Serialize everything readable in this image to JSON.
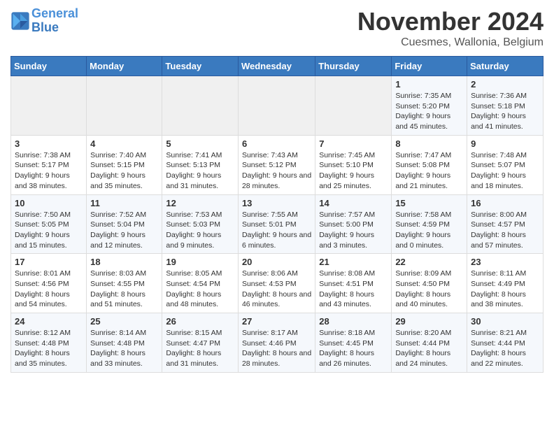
{
  "header": {
    "logo_line1": "General",
    "logo_line2": "Blue",
    "month": "November 2024",
    "location": "Cuesmes, Wallonia, Belgium"
  },
  "weekdays": [
    "Sunday",
    "Monday",
    "Tuesday",
    "Wednesday",
    "Thursday",
    "Friday",
    "Saturday"
  ],
  "weeks": [
    [
      {
        "day": "",
        "info": ""
      },
      {
        "day": "",
        "info": ""
      },
      {
        "day": "",
        "info": ""
      },
      {
        "day": "",
        "info": ""
      },
      {
        "day": "",
        "info": ""
      },
      {
        "day": "1",
        "info": "Sunrise: 7:35 AM\nSunset: 5:20 PM\nDaylight: 9 hours and 45 minutes."
      },
      {
        "day": "2",
        "info": "Sunrise: 7:36 AM\nSunset: 5:18 PM\nDaylight: 9 hours and 41 minutes."
      }
    ],
    [
      {
        "day": "3",
        "info": "Sunrise: 7:38 AM\nSunset: 5:17 PM\nDaylight: 9 hours and 38 minutes."
      },
      {
        "day": "4",
        "info": "Sunrise: 7:40 AM\nSunset: 5:15 PM\nDaylight: 9 hours and 35 minutes."
      },
      {
        "day": "5",
        "info": "Sunrise: 7:41 AM\nSunset: 5:13 PM\nDaylight: 9 hours and 31 minutes."
      },
      {
        "day": "6",
        "info": "Sunrise: 7:43 AM\nSunset: 5:12 PM\nDaylight: 9 hours and 28 minutes."
      },
      {
        "day": "7",
        "info": "Sunrise: 7:45 AM\nSunset: 5:10 PM\nDaylight: 9 hours and 25 minutes."
      },
      {
        "day": "8",
        "info": "Sunrise: 7:47 AM\nSunset: 5:08 PM\nDaylight: 9 hours and 21 minutes."
      },
      {
        "day": "9",
        "info": "Sunrise: 7:48 AM\nSunset: 5:07 PM\nDaylight: 9 hours and 18 minutes."
      }
    ],
    [
      {
        "day": "10",
        "info": "Sunrise: 7:50 AM\nSunset: 5:05 PM\nDaylight: 9 hours and 15 minutes."
      },
      {
        "day": "11",
        "info": "Sunrise: 7:52 AM\nSunset: 5:04 PM\nDaylight: 9 hours and 12 minutes."
      },
      {
        "day": "12",
        "info": "Sunrise: 7:53 AM\nSunset: 5:03 PM\nDaylight: 9 hours and 9 minutes."
      },
      {
        "day": "13",
        "info": "Sunrise: 7:55 AM\nSunset: 5:01 PM\nDaylight: 9 hours and 6 minutes."
      },
      {
        "day": "14",
        "info": "Sunrise: 7:57 AM\nSunset: 5:00 PM\nDaylight: 9 hours and 3 minutes."
      },
      {
        "day": "15",
        "info": "Sunrise: 7:58 AM\nSunset: 4:59 PM\nDaylight: 9 hours and 0 minutes."
      },
      {
        "day": "16",
        "info": "Sunrise: 8:00 AM\nSunset: 4:57 PM\nDaylight: 8 hours and 57 minutes."
      }
    ],
    [
      {
        "day": "17",
        "info": "Sunrise: 8:01 AM\nSunset: 4:56 PM\nDaylight: 8 hours and 54 minutes."
      },
      {
        "day": "18",
        "info": "Sunrise: 8:03 AM\nSunset: 4:55 PM\nDaylight: 8 hours and 51 minutes."
      },
      {
        "day": "19",
        "info": "Sunrise: 8:05 AM\nSunset: 4:54 PM\nDaylight: 8 hours and 48 minutes."
      },
      {
        "day": "20",
        "info": "Sunrise: 8:06 AM\nSunset: 4:53 PM\nDaylight: 8 hours and 46 minutes."
      },
      {
        "day": "21",
        "info": "Sunrise: 8:08 AM\nSunset: 4:51 PM\nDaylight: 8 hours and 43 minutes."
      },
      {
        "day": "22",
        "info": "Sunrise: 8:09 AM\nSunset: 4:50 PM\nDaylight: 8 hours and 40 minutes."
      },
      {
        "day": "23",
        "info": "Sunrise: 8:11 AM\nSunset: 4:49 PM\nDaylight: 8 hours and 38 minutes."
      }
    ],
    [
      {
        "day": "24",
        "info": "Sunrise: 8:12 AM\nSunset: 4:48 PM\nDaylight: 8 hours and 35 minutes."
      },
      {
        "day": "25",
        "info": "Sunrise: 8:14 AM\nSunset: 4:48 PM\nDaylight: 8 hours and 33 minutes."
      },
      {
        "day": "26",
        "info": "Sunrise: 8:15 AM\nSunset: 4:47 PM\nDaylight: 8 hours and 31 minutes."
      },
      {
        "day": "27",
        "info": "Sunrise: 8:17 AM\nSunset: 4:46 PM\nDaylight: 8 hours and 28 minutes."
      },
      {
        "day": "28",
        "info": "Sunrise: 8:18 AM\nSunset: 4:45 PM\nDaylight: 8 hours and 26 minutes."
      },
      {
        "day": "29",
        "info": "Sunrise: 8:20 AM\nSunset: 4:44 PM\nDaylight: 8 hours and 24 minutes."
      },
      {
        "day": "30",
        "info": "Sunrise: 8:21 AM\nSunset: 4:44 PM\nDaylight: 8 hours and 22 minutes."
      }
    ]
  ]
}
